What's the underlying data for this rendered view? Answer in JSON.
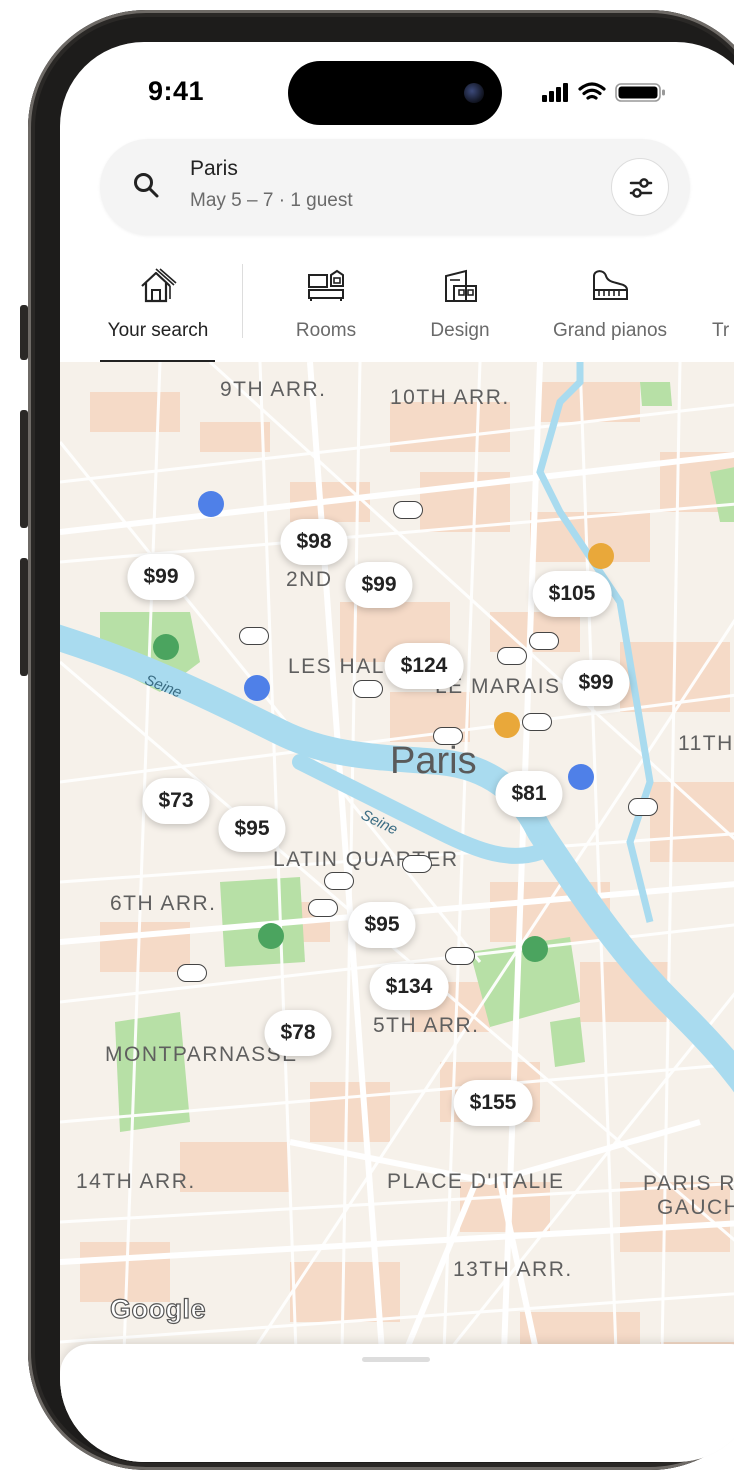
{
  "status_bar": {
    "time": "9:41"
  },
  "search": {
    "title": "Paris",
    "subtitle": "May 5 – 7 · 1 guest"
  },
  "categories": [
    {
      "label": "Your search",
      "icon": "house-icon",
      "active": true
    },
    {
      "label": "Rooms",
      "icon": "room-icon",
      "active": false
    },
    {
      "label": "Design",
      "icon": "design-building-icon",
      "active": false
    },
    {
      "label": "Grand pianos",
      "icon": "piano-icon",
      "active": false
    },
    {
      "label": "Tr",
      "icon": "more-category",
      "active": false
    }
  ],
  "map": {
    "city_label": "Paris",
    "areas": {
      "arr9": "9TH ARR.",
      "arr10": "10TH ARR.",
      "arr2": "2ND",
      "les_halles": "LES HAL",
      "marais": "LE MARAIS",
      "arr11": "11TH",
      "latin": "LATIN QUARTER",
      "arr6": "6TH ARR.",
      "arr5": "5TH ARR.",
      "montparnasse": "MONTPARNASSE",
      "arr14": "14TH ARR.",
      "place_italie": "PLACE D'ITALIE",
      "paris_rive_gauche_1": "PARIS R",
      "paris_rive_gauche_2": "GAUCH",
      "arr13": "13TH ARR."
    },
    "river_labels": [
      "Seine",
      "Seine"
    ],
    "prices": [
      "$98",
      "$99",
      "$99",
      "$105",
      "$124",
      "$99",
      "$81",
      "$73",
      "$95",
      "$95",
      "$134",
      "$78",
      "$155"
    ],
    "attribution": "Google",
    "colors": {
      "land": "#f6f1ea",
      "water": "#a9dbef",
      "park": "#b6dfa5",
      "blocks": "#f6d6c0"
    }
  }
}
